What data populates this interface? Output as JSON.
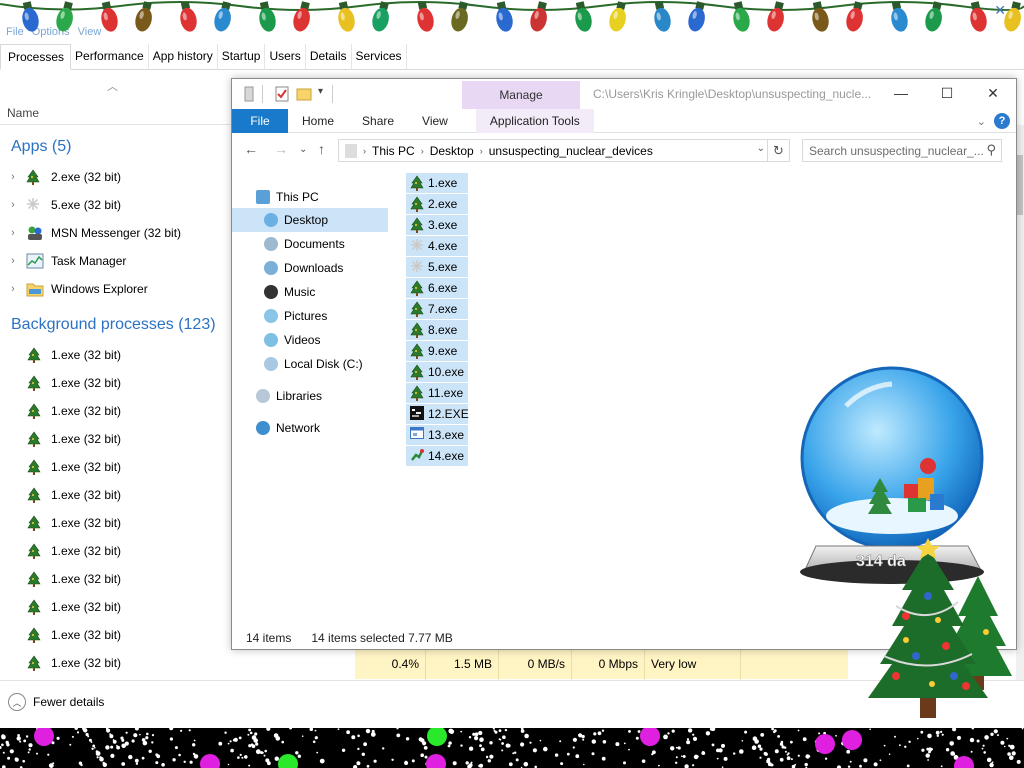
{
  "taskmanager": {
    "menu": [
      "File",
      "Options",
      "View"
    ],
    "tabs": [
      "Processes",
      "Performance",
      "App history",
      "Startup",
      "Users",
      "Details",
      "Services"
    ],
    "active_tab": "Processes",
    "column_name": "Name",
    "apps_group": "Apps (5)",
    "apps": [
      {
        "label": "2.exe (32 bit)",
        "icon": "tree-icon"
      },
      {
        "label": "5.exe (32 bit)",
        "icon": "snowflake-icon"
      },
      {
        "label": "MSN Messenger (32 bit)",
        "icon": "msn-icon"
      },
      {
        "label": "Task Manager",
        "icon": "taskmanager-icon"
      },
      {
        "label": "Windows Explorer",
        "icon": "folder-icon"
      }
    ],
    "bg_group": "Background processes (123)",
    "bg_processes": [
      "1.exe (32 bit)",
      "1.exe (32 bit)",
      "1.exe (32 bit)",
      "1.exe (32 bit)",
      "1.exe (32 bit)",
      "1.exe (32 bit)",
      "1.exe (32 bit)",
      "1.exe (32 bit)",
      "1.exe (32 bit)",
      "1.exe (32 bit)",
      "1.exe (32 bit)",
      "1.exe (32 bit)"
    ],
    "stats": {
      "cpu": "0.4%",
      "memory": "1.5 MB",
      "disk": "0 MB/s",
      "network": "0 Mbps",
      "power": "Very low"
    },
    "fewer_details": "Fewer details"
  },
  "explorer": {
    "manage_label": "Manage",
    "title_path": "C:\\Users\\Kris Kringle\\Desktop\\unsuspecting_nucle...",
    "ribbon_tabs": [
      "File",
      "Home",
      "Share",
      "View"
    ],
    "application_tools": "Application Tools",
    "breadcrumb": [
      "This PC",
      "Desktop",
      "unsuspecting_nuclear_devices"
    ],
    "search_placeholder": "Search unsuspecting_nuclear_...",
    "nav": {
      "this_pc": "This PC",
      "desktop": "Desktop",
      "documents": "Documents",
      "downloads": "Downloads",
      "music": "Music",
      "pictures": "Pictures",
      "videos": "Videos",
      "local_disk": "Local Disk (C:)",
      "libraries": "Libraries",
      "network": "Network"
    },
    "files": [
      {
        "name": "1.exe",
        "icon": "tree-icon"
      },
      {
        "name": "2.exe",
        "icon": "tree-icon"
      },
      {
        "name": "3.exe",
        "icon": "tree-icon"
      },
      {
        "name": "4.exe",
        "icon": "snowflake-icon"
      },
      {
        "name": "5.exe",
        "icon": "snowflake-icon"
      },
      {
        "name": "6.exe",
        "icon": "tree-icon"
      },
      {
        "name": "7.exe",
        "icon": "tree-icon"
      },
      {
        "name": "8.exe",
        "icon": "tree-icon"
      },
      {
        "name": "9.exe",
        "icon": "tree-icon"
      },
      {
        "name": "10.exe",
        "icon": "tree-icon"
      },
      {
        "name": "11.exe",
        "icon": "tree-icon"
      },
      {
        "name": "12.EXE",
        "icon": "console-icon"
      },
      {
        "name": "13.exe",
        "icon": "window-icon"
      },
      {
        "name": "14.exe",
        "icon": "elf-icon"
      }
    ],
    "status_count": "14 items",
    "status_selected": "14 items selected  7.77 MB"
  },
  "globe_label": "314 da",
  "colors": {
    "accent": "#1979ca",
    "selection": "#cce4f7",
    "group_blue": "#2b71c4",
    "manage_bg": "#e8d8f4"
  }
}
